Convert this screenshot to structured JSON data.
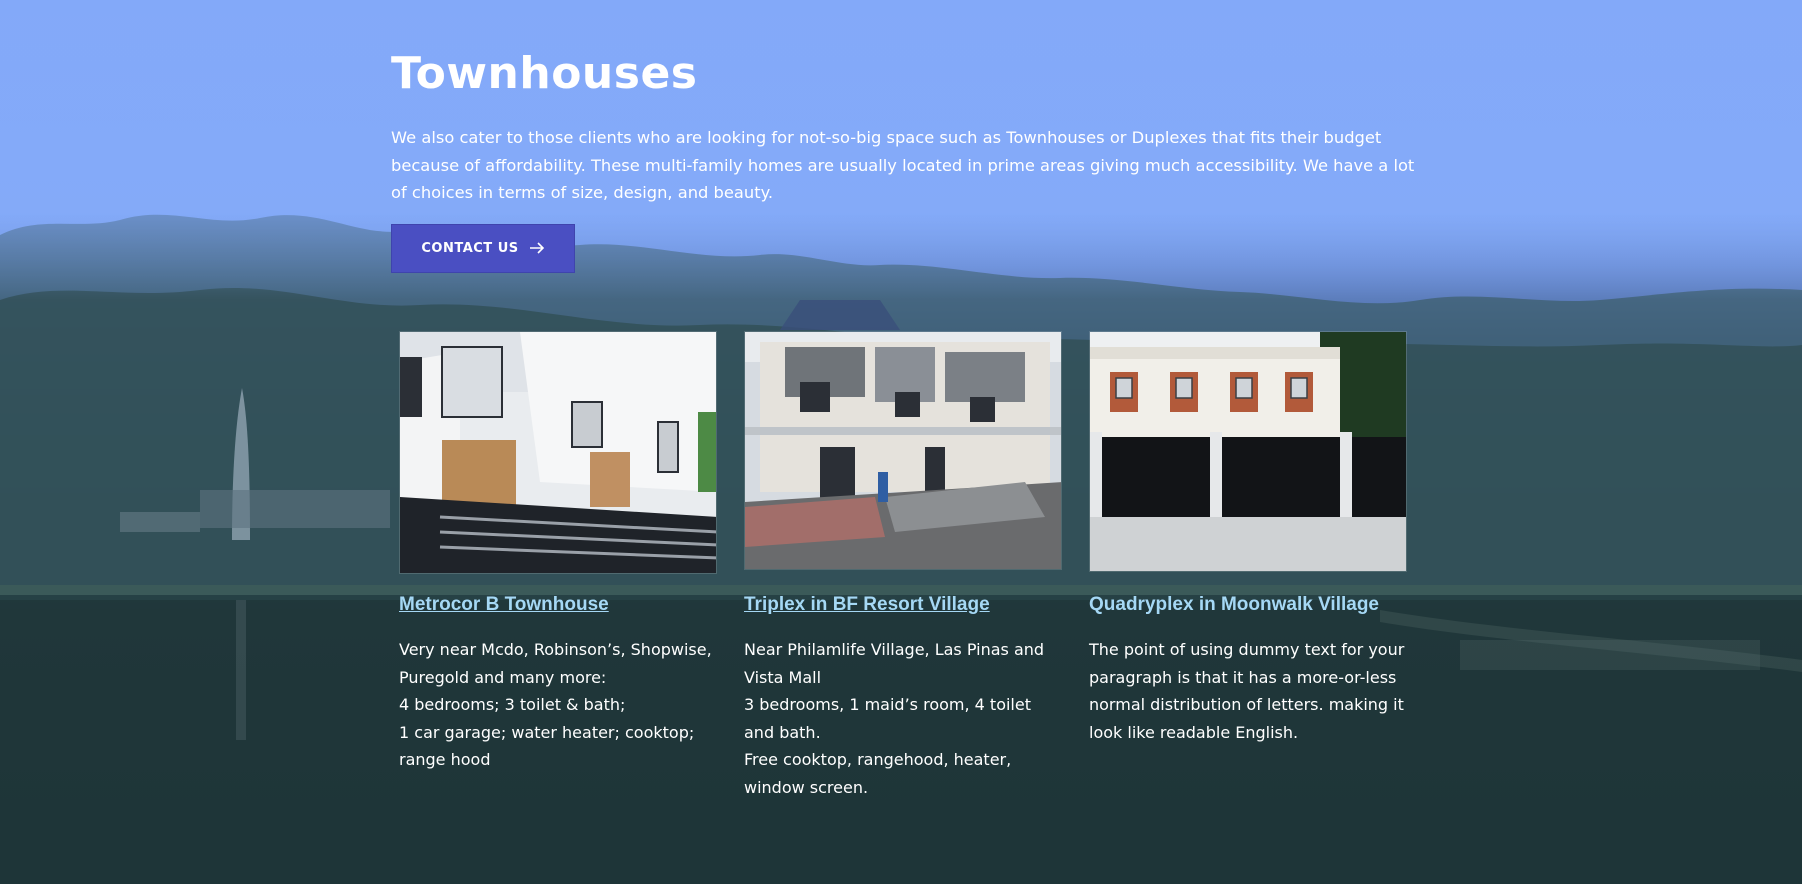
{
  "section": {
    "title": "Townhouses",
    "intro": "We also cater to those clients who are looking for not-so-big space such as Townhouses or Duplexes that fits their budget because of affordability. These multi-family homes are usually located in prime areas giving much accessibility. We have a lot of choices in terms of size, design, and beauty.",
    "contact_label": "CONTACT US",
    "contact_icon": "arrow-right-icon"
  },
  "cards": [
    {
      "name": "Metrocor B Townhouse",
      "lines": [
        "Very near Mcdo, Robinson’s, Shopwise,",
        "Puregold and many more:",
        "4 bedrooms; 3 toilet & bath;",
        "1 car garage; water heater; cooktop;",
        "range hood"
      ]
    },
    {
      "name": "Triplex in BF Resort Village",
      "lines": [
        "Near  Philamlife Village, Las Pinas and",
        "Vista Mall",
        "3 bedrooms,  1 maid’s room, 4 toilet",
        "and bath.",
        "Free cooktop, rangehood, heater,",
        "window screen."
      ]
    },
    {
      "name": "Quadryplex in Moonwalk Village",
      "lines": [
        "The point of using dummy text for your",
        "paragraph is that it has a more-or-less",
        "normal distribution of letters. making it",
        "look like readable English."
      ]
    }
  ],
  "colors": {
    "accent_button": "#4a4fc2",
    "link": "#a5d8f5",
    "sky": "#83aaf6"
  }
}
